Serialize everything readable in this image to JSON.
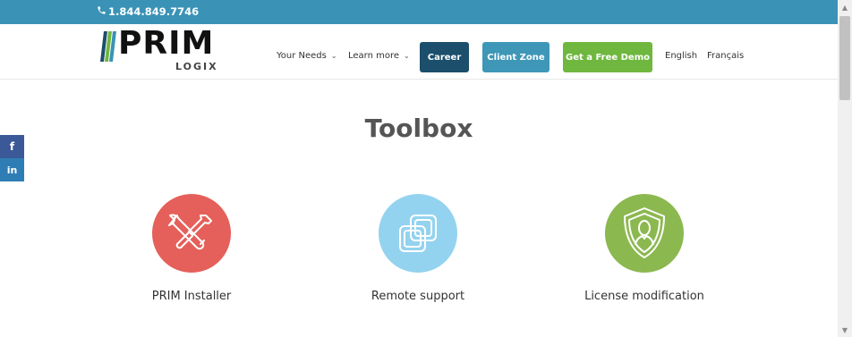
{
  "topbar": {
    "phone": "1.844.849.7746",
    "phone_icon": "phone-icon"
  },
  "logo": {
    "word": "PRIM",
    "sub": "LOGIX"
  },
  "nav": {
    "your_needs": "Your Needs",
    "learn_more": "Learn more",
    "career": "Career",
    "client_zone": "Client Zone",
    "demo": "Get a Free Demo",
    "english": "English",
    "francais": "Français"
  },
  "social": {
    "facebook": "f",
    "linkedin": "in"
  },
  "main": {
    "title": "Toolbox",
    "tools": [
      {
        "label": "PRIM Installer",
        "icon": "wrench-screwdriver-icon",
        "color": "#e5605a"
      },
      {
        "label": "Remote support",
        "icon": "overlapping-squares-icon",
        "color": "#93d3f0"
      },
      {
        "label": "License modification",
        "icon": "shield-user-icon",
        "color": "#8cb850"
      }
    ]
  },
  "colors": {
    "topbar": "#3a93b6",
    "career": "#1b4f6b",
    "client_zone": "#3f97b8",
    "demo": "#6fb73f",
    "facebook": "#3b5998",
    "linkedin": "#2f7db5"
  }
}
